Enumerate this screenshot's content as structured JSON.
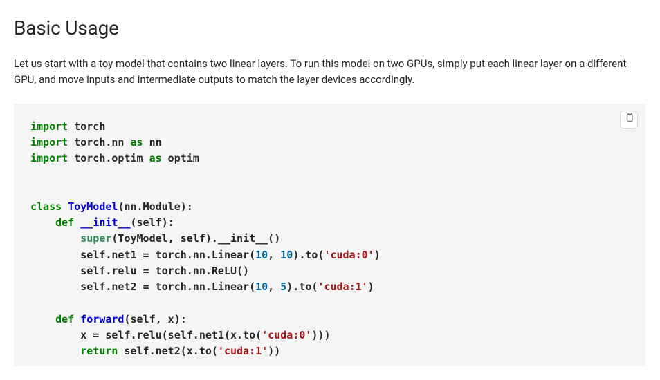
{
  "heading": "Basic Usage",
  "intro": "Let us start with a toy model that contains two linear layers. To run this model on two GPUs, simply put each linear layer on a different GPU, and move inputs and intermediate outputs to match the layer devices accordingly.",
  "copy_button_label": "Copy",
  "code": {
    "lines": [
      [
        {
          "cls": "kw",
          "t": "import"
        },
        {
          "cls": "plain",
          "t": " torch"
        }
      ],
      [
        {
          "cls": "kw",
          "t": "import"
        },
        {
          "cls": "plain",
          "t": " torch.nn "
        },
        {
          "cls": "kw",
          "t": "as"
        },
        {
          "cls": "plain",
          "t": " nn"
        }
      ],
      [
        {
          "cls": "kw",
          "t": "import"
        },
        {
          "cls": "plain",
          "t": " torch.optim "
        },
        {
          "cls": "kw",
          "t": "as"
        },
        {
          "cls": "plain",
          "t": " optim"
        }
      ],
      [],
      [],
      [
        {
          "cls": "kw",
          "t": "class"
        },
        {
          "cls": "plain",
          "t": " "
        },
        {
          "cls": "cls",
          "t": "ToyModel"
        },
        {
          "cls": "plain",
          "t": "(nn.Module):"
        }
      ],
      [
        {
          "cls": "plain",
          "t": "    "
        },
        {
          "cls": "kw",
          "t": "def"
        },
        {
          "cls": "plain",
          "t": " "
        },
        {
          "cls": "func",
          "t": "__init__"
        },
        {
          "cls": "plain",
          "t": "(self):"
        }
      ],
      [
        {
          "cls": "plain",
          "t": "        "
        },
        {
          "cls": "call",
          "t": "super"
        },
        {
          "cls": "plain",
          "t": "(ToyModel, self).__init__()"
        }
      ],
      [
        {
          "cls": "plain",
          "t": "        self.net1 = torch.nn.Linear("
        },
        {
          "cls": "num",
          "t": "10"
        },
        {
          "cls": "plain",
          "t": ", "
        },
        {
          "cls": "num",
          "t": "10"
        },
        {
          "cls": "plain",
          "t": ").to("
        },
        {
          "cls": "str",
          "t": "'cuda:0'"
        },
        {
          "cls": "plain",
          "t": ")"
        }
      ],
      [
        {
          "cls": "plain",
          "t": "        self.relu = torch.nn.ReLU()"
        }
      ],
      [
        {
          "cls": "plain",
          "t": "        self.net2 = torch.nn.Linear("
        },
        {
          "cls": "num",
          "t": "10"
        },
        {
          "cls": "plain",
          "t": ", "
        },
        {
          "cls": "num",
          "t": "5"
        },
        {
          "cls": "plain",
          "t": ").to("
        },
        {
          "cls": "str",
          "t": "'cuda:1'"
        },
        {
          "cls": "plain",
          "t": ")"
        }
      ],
      [],
      [
        {
          "cls": "plain",
          "t": "    "
        },
        {
          "cls": "kw",
          "t": "def"
        },
        {
          "cls": "plain",
          "t": " "
        },
        {
          "cls": "func",
          "t": "forward"
        },
        {
          "cls": "plain",
          "t": "(self, x):"
        }
      ],
      [
        {
          "cls": "plain",
          "t": "        x = self.relu(self.net1(x.to("
        },
        {
          "cls": "str",
          "t": "'cuda:0'"
        },
        {
          "cls": "plain",
          "t": ")))"
        }
      ],
      [
        {
          "cls": "plain",
          "t": "        "
        },
        {
          "cls": "kw",
          "t": "return"
        },
        {
          "cls": "plain",
          "t": " self.net2(x.to("
        },
        {
          "cls": "str",
          "t": "'cuda:1'"
        },
        {
          "cls": "plain",
          "t": "))"
        }
      ]
    ]
  }
}
